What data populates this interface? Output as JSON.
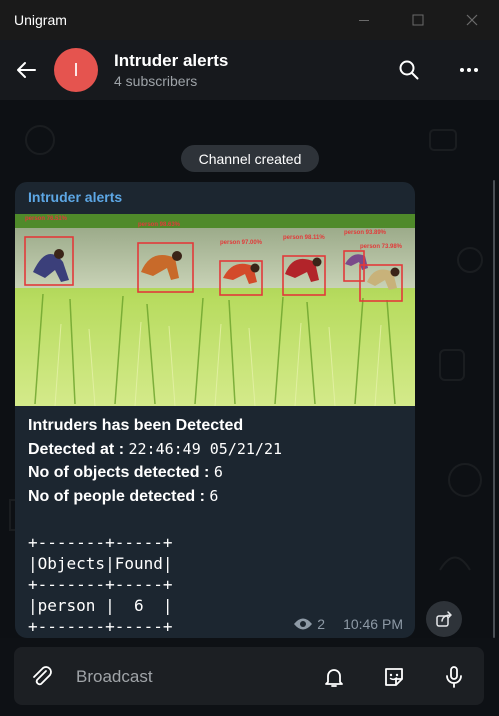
{
  "window": {
    "title": "Unigram",
    "controls": [
      "minimize-icon",
      "maximize-icon",
      "close-icon"
    ]
  },
  "header": {
    "avatar_letter": "I",
    "avatar_color": "#e5544f",
    "channel_name": "Intruder alerts",
    "subscribers": "4 subscribers",
    "icons": [
      "back-arrow-icon",
      "search-icon",
      "more-dots-icon"
    ]
  },
  "chat": {
    "service_message": "Channel created",
    "message": {
      "sender": "Intruder alerts",
      "photo": {
        "detections": [
          {
            "label": "person 76.51%"
          },
          {
            "label": "person 98.63%"
          },
          {
            "label": "person 97.00%"
          },
          {
            "label": "person 98.11%"
          },
          {
            "label": "person 93.89%"
          },
          {
            "label": "person 73.98%"
          }
        ]
      },
      "caption": {
        "line1": "Intruders has been Detected",
        "detected_at_label": "Detected at :",
        "detected_at_value": "22:46:49 05/21/21",
        "objects_label": "No of objects detected :",
        "objects_value": "6",
        "people_label": "No of people detected :",
        "people_value": "6"
      },
      "table_text": "+-------+-----+\n|Objects|Found|\n+-------+-----+\n|person |  6  |\n+-------+-----+",
      "views": "2",
      "time": "10:46 PM"
    },
    "accent_color": "#5da7e5"
  },
  "composer": {
    "placeholder": "Broadcast",
    "icons": [
      "attach-icon",
      "bell-icon",
      "sticker-icon",
      "microphone-icon"
    ]
  }
}
